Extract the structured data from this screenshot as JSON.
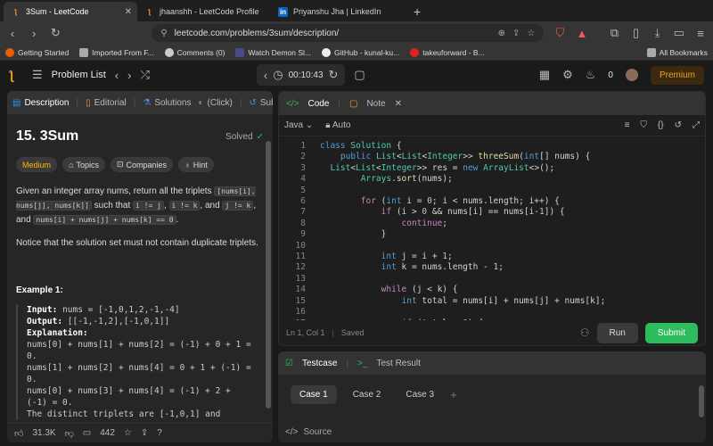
{
  "browser": {
    "tabs": [
      {
        "title": "3Sum - LeetCode",
        "favicon": "leetcode-icon",
        "active": true
      },
      {
        "title": "jhaanshh - LeetCode Profile",
        "favicon": "leetcode-icon",
        "active": false
      },
      {
        "title": "Priyanshu Jha | LinkedIn",
        "favicon": "linkedin-icon",
        "active": false
      }
    ],
    "new_tab": "+",
    "url": "leetcode.com/problems/3sum/description/",
    "bookmarks": [
      "Getting Started",
      "Imported From F...",
      "Comments (0)",
      "Watch Demon Sl...",
      "GitHub - kunal-ku...",
      "takeuforward - B..."
    ],
    "all_bookmarks": "All Bookmarks"
  },
  "header": {
    "problem_list": "Problem List",
    "timer": "00:10:43",
    "fire_count": "0",
    "premium": "Premium"
  },
  "left": {
    "tabs": [
      "Description",
      "Editorial",
      "Solutions",
      "(Click)",
      "Submi"
    ],
    "title": "15. 3Sum",
    "solved": "Solved",
    "chips": [
      "Medium",
      "Topics",
      "Companies",
      "Hint"
    ],
    "desc_1": "Given an integer array nums, return all the triplets",
    "code_triplet": "[nums[i], nums[j], nums[k]]",
    "desc_2": "such that",
    "code_ij": "i != j",
    "code_ik": "i != k",
    "desc_and": ", and",
    "code_jk": "j != k",
    "desc_3": ", and",
    "code_sum": "nums[i] + nums[j] + nums[k] == 0",
    "note": "Notice that the solution set must not contain duplicate triplets.",
    "example_title": "Example 1:",
    "ex_input_label": "Input:",
    "ex_input": "nums = [-1,0,1,2,-1,-4]",
    "ex_output_label": "Output:",
    "ex_output": "[[-1,-1,2],[-1,0,1]]",
    "ex_expl_label": "Explanation:",
    "ex_lines": [
      "nums[0] + nums[1] + nums[2] = (-1) + 0 + 1 =",
      "0.",
      "nums[1] + nums[2] + nums[4] = 0 + 1 + (-1) =",
      "0.",
      "nums[0] + nums[3] + nums[4] = (-1) + 2 +",
      "(-1) = 0.",
      "The distinct triplets are [-1,0,1] and"
    ],
    "likes": "31.3K",
    "comments": "442"
  },
  "editor": {
    "tab_code": "Code",
    "tab_note": "Note",
    "language": "Java",
    "auto": "Auto",
    "cursor": "Ln 1, Col 1",
    "saved": "Saved",
    "run": "Run",
    "submit": "Submit"
  },
  "testcase": {
    "tab_testcase": "Testcase",
    "tab_result": "Test Result",
    "cases": [
      "Case 1",
      "Case 2",
      "Case 3"
    ],
    "source": "Source"
  }
}
